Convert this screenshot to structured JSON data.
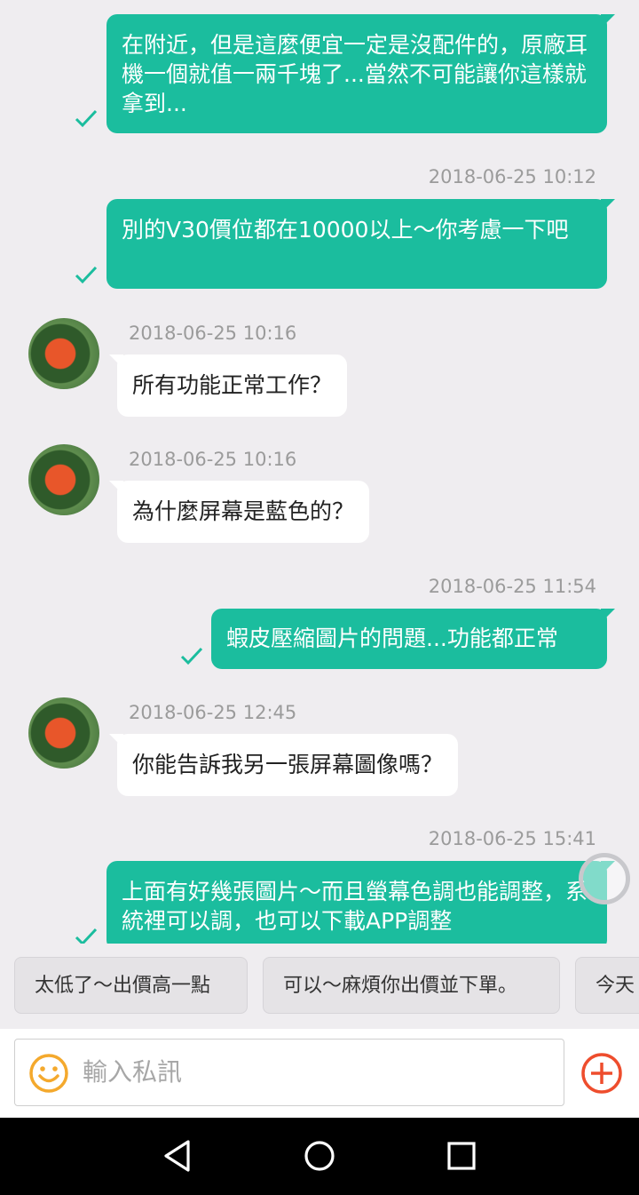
{
  "messages": [
    {
      "type": "sent",
      "text": "在附近，但是這麼便宜一定是沒配件的，原廠耳機一個就值一兩千塊了...當然不可能讓你這樣就拿到..."
    },
    {
      "type": "sent",
      "timestamp": "2018-06-25 10:12",
      "text": "別的V30價位都在10000以上～你考慮一下吧"
    },
    {
      "type": "received",
      "timestamp": "2018-06-25 10:16",
      "text": "所有功能正常工作？"
    },
    {
      "type": "received",
      "timestamp": "2018-06-25 10:16",
      "text": "為什麼屏幕是藍色的？"
    },
    {
      "type": "sent",
      "timestamp": "2018-06-25 11:54",
      "text": "蝦皮壓縮圖片的問題...功能都正常"
    },
    {
      "type": "received",
      "timestamp": "2018-06-25 12:45",
      "text": "你能告訴我另一張屏幕圖像嗎？"
    },
    {
      "type": "sent",
      "timestamp": "2018-06-25 15:41",
      "text": "上面有好幾張圖片～而且螢幕色調也能調整，系統裡可以調，也可以下載APP調整"
    }
  ],
  "quick_replies": [
    "太低了～出價高一點",
    "可以～麻煩你出價並下單。",
    "今天"
  ],
  "input": {
    "placeholder": "輸入私訊"
  },
  "icons": {
    "emoji": "emoji-icon",
    "add": "plus-circle-icon",
    "back": "back-icon",
    "home": "home-icon",
    "recents": "recents-icon"
  },
  "colors": {
    "sent_bubble": "#1bbd9e",
    "received_bubble": "#ffffff",
    "background": "#efedf0",
    "accent": "#ee4d2d",
    "emoji": "#f4a92d"
  }
}
